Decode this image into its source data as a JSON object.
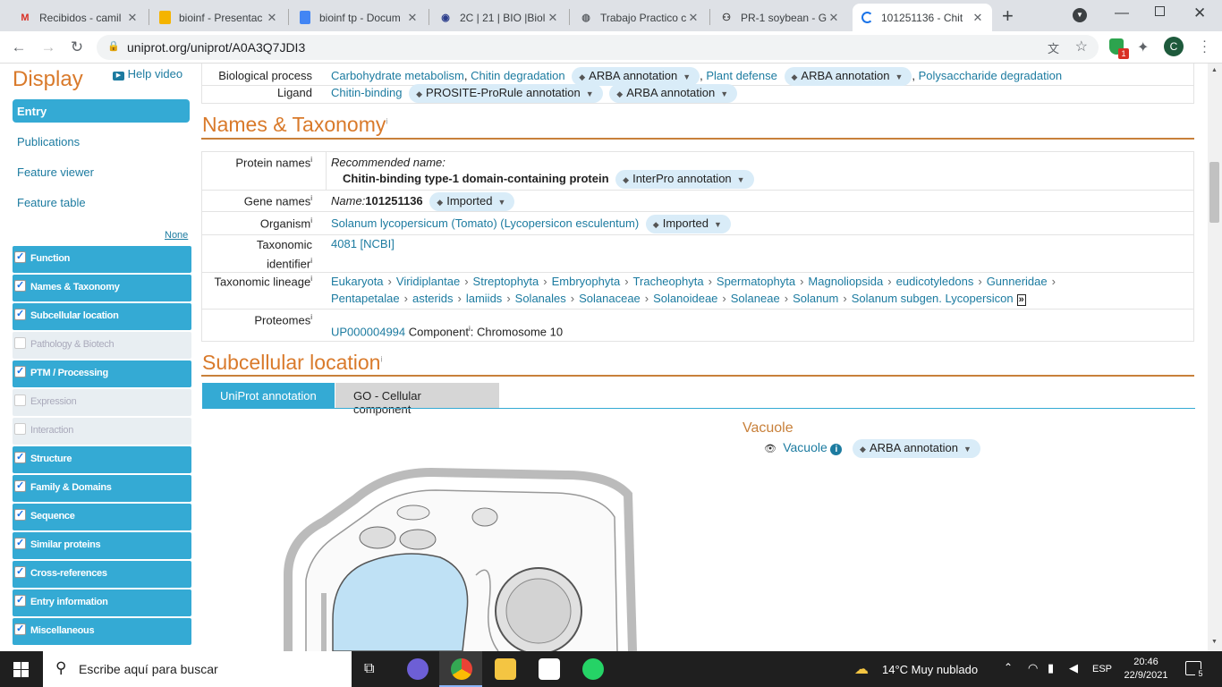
{
  "browser": {
    "tabs": [
      {
        "title": "Recibidos - camil",
        "icon": "gmail-icon"
      },
      {
        "title": "bioinf - Presentac",
        "icon": "slides-icon"
      },
      {
        "title": "bioinf tp - Docum",
        "icon": "docs-icon"
      },
      {
        "title": "2C | 21 | BIO |Biol",
        "icon": "moodle-icon"
      },
      {
        "title": "Trabajo Practico c",
        "icon": "globe-icon"
      },
      {
        "title": "PR-1 soybean - G",
        "icon": "github-icon"
      },
      {
        "title": "101251136 - Chit",
        "icon": "loading-icon"
      }
    ],
    "url": "uniprot.org/uniprot/A0A3Q7JDI3",
    "profile_initial": "C",
    "ext_badge": "1"
  },
  "sidebar": {
    "title": "Display",
    "help_video": "Help video",
    "entry": "Entry",
    "links": [
      "Publications",
      "Feature viewer",
      "Feature table"
    ],
    "none_label": "None",
    "sections": [
      {
        "label": "Function",
        "checked": true
      },
      {
        "label": "Names & Taxonomy",
        "checked": true
      },
      {
        "label": "Subcellular location",
        "checked": true
      },
      {
        "label": "Pathology & Biotech",
        "checked": false
      },
      {
        "label": "PTM / Processing",
        "checked": true
      },
      {
        "label": "Expression",
        "checked": false
      },
      {
        "label": "Interaction",
        "checked": false
      },
      {
        "label": "Structure",
        "checked": true
      },
      {
        "label": "Family & Domains",
        "checked": true
      },
      {
        "label": "Sequence",
        "checked": true
      },
      {
        "label": "Similar proteins",
        "checked": true
      },
      {
        "label": "Cross-references",
        "checked": true
      },
      {
        "label": "Entry information",
        "checked": true
      },
      {
        "label": "Miscellaneous",
        "checked": true
      }
    ]
  },
  "function_rows": {
    "bio_label": "Biological process",
    "bio_1": "Carbohydrate metabolism",
    "bio_2": "Chitin degradation",
    "bio_3": "Plant defense",
    "bio_4": "Polysaccharide degradation",
    "ligand_label": "Ligand",
    "ligand_value": "Chitin-binding",
    "badge_arba": "ARBA annotation",
    "badge_prosite": "PROSITE-ProRule annotation"
  },
  "names": {
    "heading": "Names & Taxonomy",
    "protein_label": "Protein names",
    "recommended": "Recommended name:",
    "protein_name": "Chitin-binding type-1 domain-containing protein",
    "interpro": "InterPro annotation",
    "gene_label": "Gene names",
    "gene_prefix": "Name:",
    "gene_value": "101251136",
    "imported": "Imported",
    "organism_label": "Organism",
    "organism_value": "Solanum lycopersicum (Tomato) (Lycopersicon esculentum)",
    "taxid_label_1": "Taxonomic",
    "taxid_label_2": "identifier",
    "taxid_value": "4081",
    "taxid_ncbi": "[NCBI]",
    "lineage_label": "Taxonomic lineage",
    "lineage_line1": [
      "Eukaryota",
      "Viridiplantae",
      "Streptophyta",
      "Embryophyta",
      "Tracheophyta",
      "Spermatophyta",
      "Magnoliopsida",
      "eudicotyledons",
      "Gunneridae"
    ],
    "lineage_line2": [
      "Pentapetalae",
      "asterids",
      "lamiids",
      "Solanales",
      "Solanaceae",
      "Solanoideae",
      "Solaneae",
      "Solanum",
      "Solanum subgen. Lycopersicon"
    ],
    "proteomes_label": "Proteomes",
    "proteome_id": "UP000004994",
    "component_label": "Component",
    "component_value": ": Chromosome 10"
  },
  "subcell": {
    "heading": "Subcellular location",
    "tab1": "UniProt annotation",
    "tab2": "GO - Cellular component",
    "loc_title": "Vacuole",
    "loc_link": "Vacuole",
    "badge": "ARBA annotation"
  },
  "taskbar": {
    "search": "Escribe aquí para buscar",
    "weather": "14°C  Muy nublado",
    "lang": "ESP",
    "time": "20:46",
    "date": "22/9/2021",
    "notif": "5"
  }
}
